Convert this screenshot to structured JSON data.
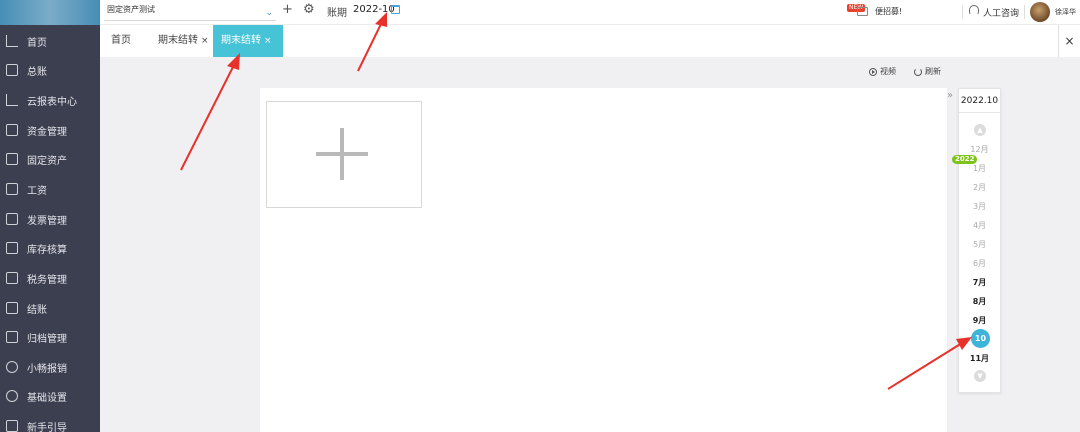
{
  "sidebar": {
    "items": [
      {
        "label": "首页",
        "icon": "home-icon"
      },
      {
        "label": "总账",
        "icon": "ledger-icon"
      },
      {
        "label": "云报表中心",
        "icon": "chart-icon"
      },
      {
        "label": "资金管理",
        "icon": "wallet-icon"
      },
      {
        "label": "固定资产",
        "icon": "building-icon"
      },
      {
        "label": "工资",
        "icon": "payroll-icon"
      },
      {
        "label": "发票管理",
        "icon": "invoice-icon"
      },
      {
        "label": "库存核算",
        "icon": "warehouse-icon"
      },
      {
        "label": "税务管理",
        "icon": "tax-icon"
      },
      {
        "label": "结账",
        "icon": "checkout-icon"
      },
      {
        "label": "归档管理",
        "icon": "archive-icon"
      },
      {
        "label": "小畅报销",
        "icon": "reimburse-icon"
      },
      {
        "label": "基础设置",
        "icon": "settings-icon"
      },
      {
        "label": "新手引导",
        "icon": "guide-icon"
      }
    ]
  },
  "topbar": {
    "company": "固定资产测试",
    "period_label": "账期",
    "period_value": "2022-10",
    "new_badge": "NEW",
    "promo": "便招募!",
    "support": "人工咨询",
    "username": "徐泽华"
  },
  "tabs": [
    {
      "label": "首页",
      "closable": false,
      "active": false
    },
    {
      "label": "期末结转",
      "closable": true,
      "active": false
    },
    {
      "label": "期末结转",
      "closable": true,
      "active": true
    }
  ],
  "toolbar": {
    "video": "视频",
    "refresh": "刷新"
  },
  "period_picker": {
    "current": "2022.10",
    "year_badge": "2022",
    "months": [
      {
        "label": "12月",
        "style": "muted"
      },
      {
        "label": "1月",
        "style": "muted"
      },
      {
        "label": "2月",
        "style": "muted"
      },
      {
        "label": "3月",
        "style": "muted"
      },
      {
        "label": "4月",
        "style": "muted"
      },
      {
        "label": "5月",
        "style": "muted"
      },
      {
        "label": "6月",
        "style": "muted"
      },
      {
        "label": "7月",
        "style": "bold"
      },
      {
        "label": "8月",
        "style": "bold"
      },
      {
        "label": "9月",
        "style": "bold"
      },
      {
        "label": "10月",
        "style": "selected"
      },
      {
        "label": "11月",
        "style": "bold"
      }
    ]
  },
  "colors": {
    "sidebar_bg": "#3c3f50",
    "accent": "#46c3d6",
    "selected_month": "#3fb4d9",
    "year_badge": "#7ec21c",
    "annotation_arrow": "#e8312a"
  }
}
